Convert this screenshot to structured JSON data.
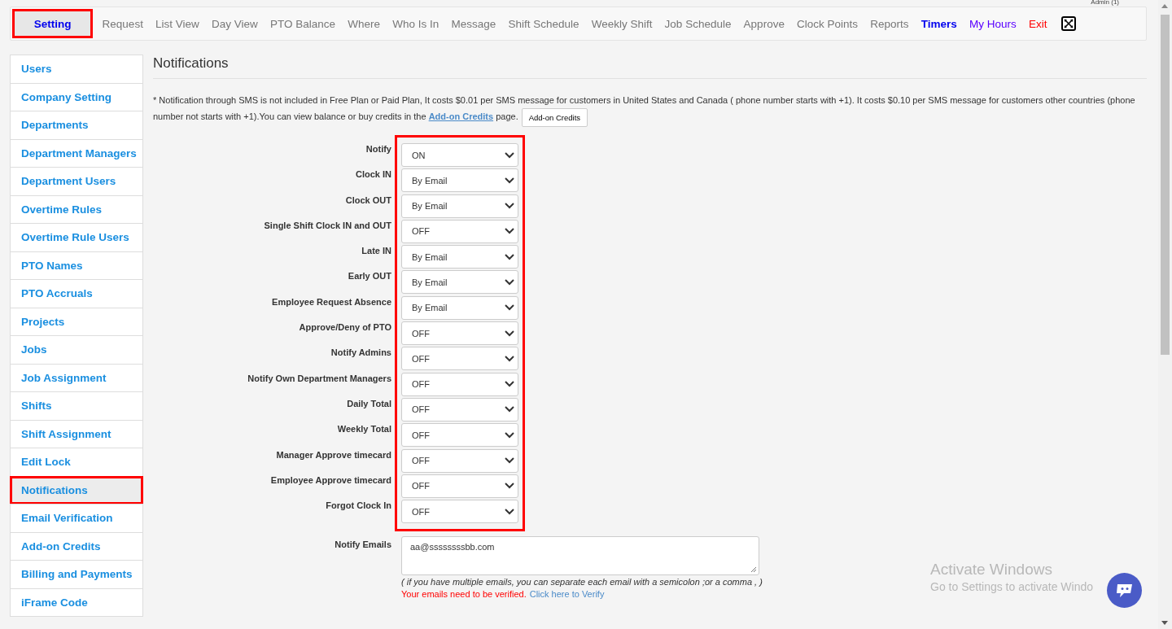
{
  "user_badge": "Admin (1)",
  "nav": [
    {
      "label": "Setting",
      "kind": "tab",
      "selected": true,
      "highlighted": true
    },
    {
      "label": "Request",
      "kind": "tab",
      "selected": false,
      "highlighted": false
    },
    {
      "label": "List View",
      "kind": "tab",
      "selected": false,
      "highlighted": false
    },
    {
      "label": "Day View",
      "kind": "tab",
      "selected": false,
      "highlighted": false
    },
    {
      "label": "PTO Balance",
      "kind": "tab",
      "selected": false,
      "highlighted": false
    },
    {
      "label": "Where",
      "kind": "tab",
      "selected": false,
      "highlighted": false
    },
    {
      "label": "Who Is In",
      "kind": "tab",
      "selected": false,
      "highlighted": false
    },
    {
      "label": "Message",
      "kind": "tab",
      "selected": false,
      "highlighted": false
    },
    {
      "label": "Shift Schedule",
      "kind": "tab",
      "selected": false,
      "highlighted": false
    },
    {
      "label": "Weekly Shift",
      "kind": "tab",
      "selected": false,
      "highlighted": false
    },
    {
      "label": "Job Schedule",
      "kind": "tab",
      "selected": false,
      "highlighted": false
    },
    {
      "label": "Approve",
      "kind": "tab",
      "selected": false,
      "highlighted": false
    },
    {
      "label": "Clock Points",
      "kind": "tab",
      "selected": false,
      "highlighted": false
    },
    {
      "label": "Reports",
      "kind": "tab",
      "selected": false,
      "highlighted": false
    },
    {
      "label": "Timers",
      "kind": "timers",
      "selected": false,
      "highlighted": false
    },
    {
      "label": "My Hours",
      "kind": "hours",
      "selected": false,
      "highlighted": false
    },
    {
      "label": "Exit",
      "kind": "exit",
      "selected": false,
      "highlighted": false
    }
  ],
  "sidebar": {
    "items": [
      {
        "label": "Users",
        "selected": false,
        "highlighted": false
      },
      {
        "label": "Company Setting",
        "selected": false,
        "highlighted": false
      },
      {
        "label": "Departments",
        "selected": false,
        "highlighted": false
      },
      {
        "label": "Department Managers",
        "selected": false,
        "highlighted": false
      },
      {
        "label": "Department Users",
        "selected": false,
        "highlighted": false
      },
      {
        "label": "Overtime Rules",
        "selected": false,
        "highlighted": false
      },
      {
        "label": "Overtime Rule Users",
        "selected": false,
        "highlighted": false
      },
      {
        "label": "PTO Names",
        "selected": false,
        "highlighted": false
      },
      {
        "label": "PTO Accruals",
        "selected": false,
        "highlighted": false
      },
      {
        "label": "Projects",
        "selected": false,
        "highlighted": false
      },
      {
        "label": "Jobs",
        "selected": false,
        "highlighted": false
      },
      {
        "label": "Job Assignment",
        "selected": false,
        "highlighted": false
      },
      {
        "label": "Shifts",
        "selected": false,
        "highlighted": false
      },
      {
        "label": "Shift Assignment",
        "selected": false,
        "highlighted": false
      },
      {
        "label": "Edit Lock",
        "selected": false,
        "highlighted": false
      },
      {
        "label": "Notifications",
        "selected": true,
        "highlighted": true
      },
      {
        "label": "Email Verification",
        "selected": false,
        "highlighted": false
      },
      {
        "label": "Add-on Credits",
        "selected": false,
        "highlighted": false
      },
      {
        "label": "Billing and Payments",
        "selected": false,
        "highlighted": false
      },
      {
        "label": "iFrame Code",
        "selected": false,
        "highlighted": false
      }
    ]
  },
  "title": "Notifications",
  "sms_note": {
    "text": "* Notification through SMS is not included in Free Plan or Paid Plan, It costs $0.01 per SMS message for customers in United States and Canada ( phone number starts with +1). It costs $0.10 per SMS message for customers other countries (phone number not starts with +1).You can view balance or buy credits in the",
    "link": "Add-on Credits",
    "after": "page.",
    "button": "Add-on Credits"
  },
  "settings_highlighted": true,
  "settings": [
    {
      "label": "Notify",
      "value": "ON"
    },
    {
      "label": "Clock IN",
      "value": "By Email"
    },
    {
      "label": "Clock OUT",
      "value": "By Email"
    },
    {
      "label": "Single Shift Clock IN and OUT",
      "value": "OFF"
    },
    {
      "label": "Late IN",
      "value": "By Email"
    },
    {
      "label": "Early OUT",
      "value": "By Email"
    },
    {
      "label": "Employee Request Absence",
      "value": "By Email"
    },
    {
      "label": "Approve/Deny of PTO",
      "value": "OFF"
    },
    {
      "label": "Notify Admins",
      "value": "OFF"
    },
    {
      "label": "Notify Own Department Managers",
      "value": "OFF"
    },
    {
      "label": "Daily Total",
      "value": "OFF"
    },
    {
      "label": "Weekly Total",
      "value": "OFF"
    },
    {
      "label": "Manager Approve timecard",
      "value": "OFF"
    },
    {
      "label": "Employee Approve timecard",
      "value": "OFF"
    },
    {
      "label": "Forgot Clock In",
      "value": "OFF"
    }
  ],
  "notify_emails": {
    "label": "Notify Emails",
    "value": "aa@ssssssssbb.com",
    "hint": "( if you have multiple emails, you can separate each email with a semicolon ;or a comma , )",
    "warning": "Your emails need to be verified.",
    "verify_link": "Click here to Verify"
  },
  "os_notice": {
    "title": "Activate Windows",
    "text": "Go to Settings to activate Windo"
  }
}
